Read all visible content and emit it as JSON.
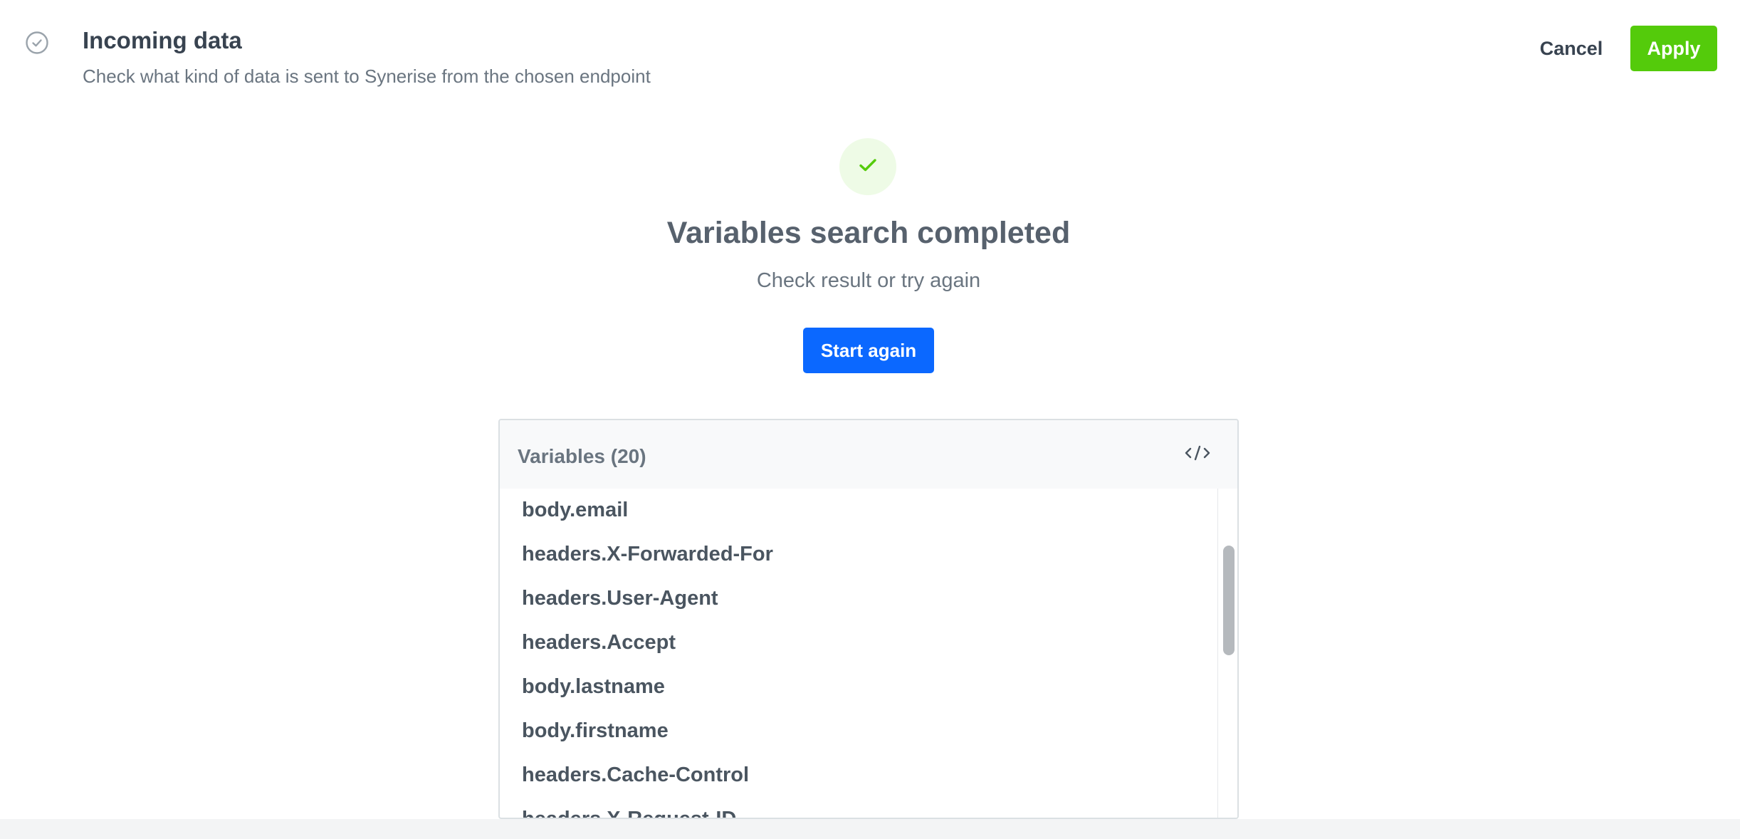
{
  "header": {
    "title": "Incoming data",
    "subtitle": "Check what kind of data is sent to Synerise from the chosen endpoint",
    "step_icon": "check-circle-icon"
  },
  "actions": {
    "cancel_label": "Cancel",
    "apply_label": "Apply"
  },
  "status": {
    "icon": "check-icon",
    "title": "Variables search completed",
    "subtitle": "Check result or try again",
    "start_again_label": "Start again"
  },
  "variables": {
    "title": "Variables (20)",
    "code_icon": "code-icon",
    "items": [
      "body.email",
      "headers.X-Forwarded-For",
      "headers.User-Agent",
      "headers.Accept",
      "body.lastname",
      "body.firstname",
      "headers.Cache-Control",
      "headers.X-Request-ID"
    ]
  },
  "colors": {
    "apply": "#54cb0b",
    "primary": "#0b68ff",
    "success": "#54cb0b",
    "text": "#384350"
  }
}
